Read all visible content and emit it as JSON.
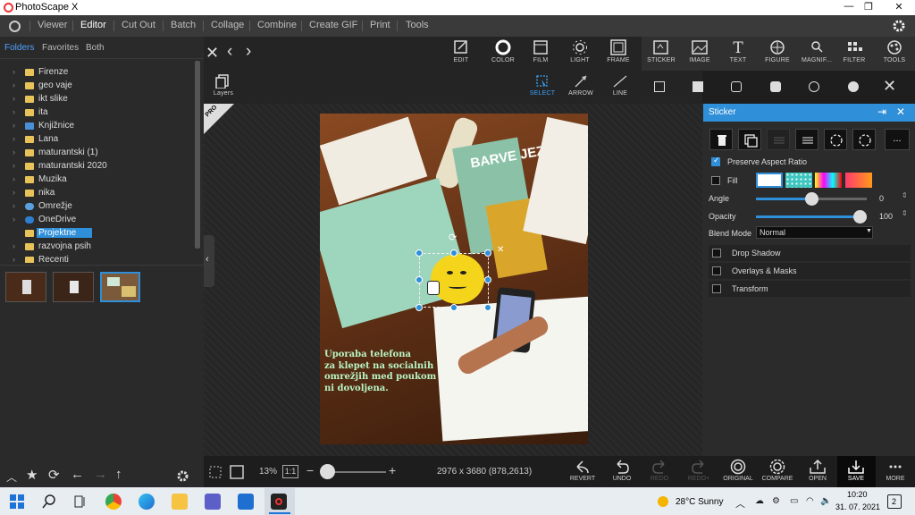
{
  "window": {
    "title": "PhotoScape X",
    "controls": {
      "minimize": "—",
      "maximize": "❐",
      "close": "✕"
    }
  },
  "menu": {
    "items": [
      "Viewer",
      "Editor",
      "Cut Out",
      "Batch",
      "Collage",
      "Combine",
      "Create GIF",
      "Print",
      "Tools"
    ],
    "active": "Editor"
  },
  "browser": {
    "tabs": [
      "Folders",
      "Favorites",
      "Both"
    ],
    "folders": [
      "Firenze",
      "geo vaje",
      "ikt slike",
      "ita",
      "Knjižnice",
      "Lana",
      "maturantski (1)",
      "maturantski 2020",
      "Muzika",
      "nika",
      "Omrežje",
      "OneDrive",
      "Projektne",
      "razvojna psih",
      "Recenti"
    ],
    "selected_folder": "Projektne"
  },
  "top_tools": [
    {
      "label": "EDIT",
      "icon": "edit-icon"
    },
    {
      "label": "COLOR",
      "icon": "color-icon"
    },
    {
      "label": "FILM",
      "icon": "film-icon"
    },
    {
      "label": "LIGHT",
      "icon": "light-icon"
    },
    {
      "label": "FRAME",
      "icon": "frame-icon"
    },
    {
      "label": "STICKER",
      "icon": "sticker-icon"
    },
    {
      "label": "IMAGE",
      "icon": "image-icon"
    },
    {
      "label": "TEXT",
      "icon": "text-icon"
    },
    {
      "label": "FIGURE",
      "icon": "figure-icon"
    },
    {
      "label": "MAGNIF...",
      "icon": "magnifier-icon"
    },
    {
      "label": "FILTER",
      "icon": "filter-icon"
    },
    {
      "label": "TOOLS",
      "icon": "tools-icon"
    }
  ],
  "sub_tools": [
    {
      "label": "SELECT",
      "icon": "select-icon",
      "active": true
    },
    {
      "label": "ARROW",
      "icon": "arrow-icon"
    },
    {
      "label": "LINE",
      "icon": "line-icon"
    }
  ],
  "layers_label": "Layers",
  "pro_badge": "PRO",
  "photo": {
    "caption": "Uporaba telefona\nza klepet na socialnih\nomrežjih med poukom\nni dovoljena.",
    "book_text": "BARVE JEZI",
    "caption_color": "#b9f5c4"
  },
  "sticker_panel": {
    "title": "Sticker",
    "preserve_aspect": "Preserve Aspect Ratio",
    "fill": "Fill",
    "angle_label": "Angle",
    "angle_value": "0",
    "angle_fraction": 0.5,
    "opacity_label": "Opacity",
    "opacity_value": "100",
    "opacity_fraction": 1.0,
    "blend_label": "Blend Mode",
    "blend_value": "Normal",
    "sections": [
      "Drop Shadow",
      "Overlays & Masks",
      "Transform"
    ],
    "more_label": "..."
  },
  "status": {
    "zoom": "13%",
    "ratio": "1:1",
    "dimensions": "2976 x 3680 (878,2613)"
  },
  "bottom_actions": [
    {
      "label": "REVERT",
      "icon": "revert-icon",
      "enabled": true
    },
    {
      "label": "UNDO",
      "icon": "undo-icon",
      "enabled": true
    },
    {
      "label": "REDO",
      "icon": "redo-icon",
      "enabled": false
    },
    {
      "label": "REDO+",
      "icon": "redo-plus-icon",
      "enabled": false
    },
    {
      "label": "ORIGINAL",
      "icon": "original-icon",
      "enabled": true
    },
    {
      "label": "COMPARE",
      "icon": "compare-icon",
      "enabled": true
    },
    {
      "label": "OPEN",
      "icon": "open-icon",
      "enabled": true
    },
    {
      "label": "SAVE",
      "icon": "save-icon",
      "enabled": true
    },
    {
      "label": "MORE",
      "icon": "more-icon",
      "enabled": true
    }
  ],
  "taskbar": {
    "weather": "28°C  Sunny",
    "time": "10:20",
    "date": "31. 07. 2021",
    "notifications": "2"
  },
  "colors": {
    "accent": "#2f8fd8",
    "menubar": "#3a3a3a",
    "panel": "#2a2a2a"
  }
}
